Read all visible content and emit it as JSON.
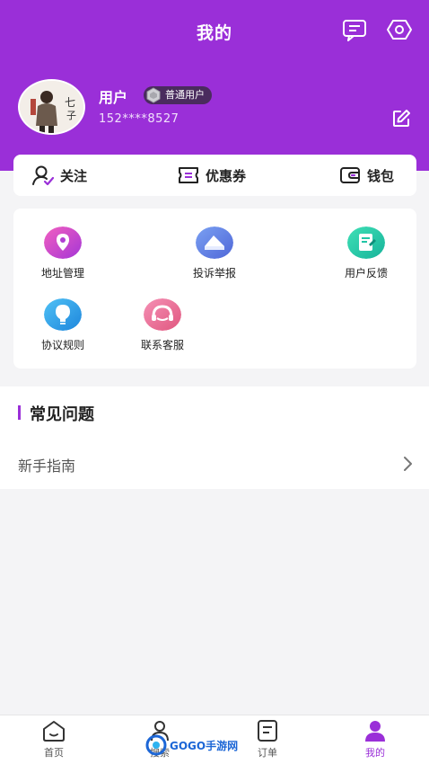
{
  "header": {
    "title": "我的",
    "bg_color": "#9a2fd8"
  },
  "profile": {
    "name": "用户",
    "badge": "普通用户",
    "phone": "152****8527"
  },
  "quickbar": {
    "items": [
      {
        "label": "关注",
        "icon": "follow-user-icon"
      },
      {
        "label": "优惠券",
        "icon": "coupon-icon"
      },
      {
        "label": "钱包",
        "icon": "wallet-icon"
      }
    ]
  },
  "services": {
    "items": [
      {
        "label": "地址管理",
        "icon": "location-pin-icon",
        "color": "#c03cd9"
      },
      {
        "label": "投诉举报",
        "icon": "complaint-icon",
        "color": "#5d7ee6"
      },
      {
        "label": "用户反馈",
        "icon": "feedback-icon",
        "color": "#21c6a6"
      },
      {
        "label": "协议规则",
        "icon": "agreement-icon",
        "color": "#2aa0e8"
      },
      {
        "label": "联系客服",
        "icon": "headset-icon",
        "color": "#e7739a"
      }
    ]
  },
  "faq": {
    "title": "常见问题",
    "rows": [
      {
        "label": "新手指南"
      }
    ]
  },
  "tabbar": {
    "items": [
      {
        "label": "首页",
        "icon": "home-icon"
      },
      {
        "label": "搜索",
        "icon": "category-icon"
      },
      {
        "label": "订单",
        "icon": "order-icon"
      },
      {
        "label": "我的",
        "icon": "profile-icon"
      }
    ],
    "active_color": "#9a2fd8"
  },
  "watermark": {
    "text": "GOGO手游网"
  }
}
